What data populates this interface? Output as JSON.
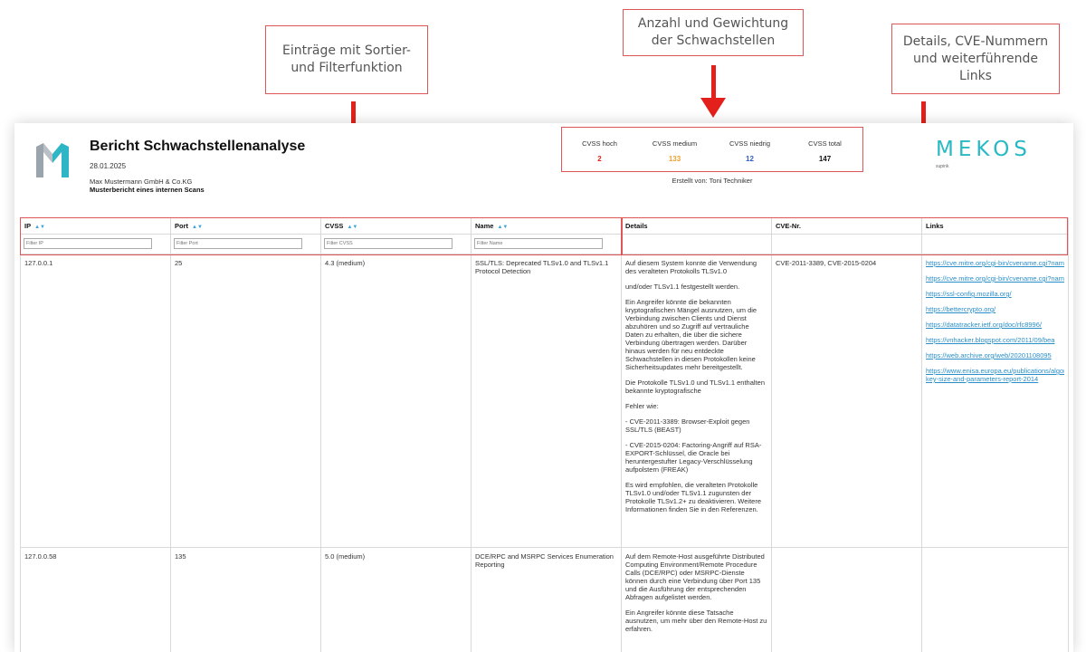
{
  "annotations": {
    "sort_filter": "Einträge mit Sortier-\nund Filterfunktion",
    "count_weight": "Anzahl und Gewichtung\nder Schwachstellen",
    "details_links": "Details, CVE-Nummern\nund weiterführende\nLinks"
  },
  "report": {
    "title": "Bericht Schwachstellenanalyse",
    "date": "28.01.2025",
    "company": "Max Mustermann GmbH & Co.KG",
    "subtitle": "Musterbericht eines internen Scans",
    "brand": "MEKOS",
    "brand_sub": "supink",
    "created_by": "Erstellt von: Toni Techniker"
  },
  "stats": [
    {
      "label": "CVSS hoch",
      "value": "2",
      "color": "#e3201b"
    },
    {
      "label": "CVSS medium",
      "value": "133",
      "color": "#f0a030"
    },
    {
      "label": "CVSS niedrig",
      "value": "12",
      "color": "#2f5fc4"
    },
    {
      "label": "CVSS total",
      "value": "147",
      "color": "#111111"
    }
  ],
  "table": {
    "headers": [
      "IP",
      "Port",
      "CVSS",
      "Name",
      "Details",
      "CVE-Nr.",
      "Links"
    ],
    "sort_icon": "▲▼",
    "filter_placeholders": [
      "Filter IP",
      "Filter Port",
      "Filter CVSS",
      "Filter Name"
    ],
    "rows": [
      {
        "ip": "127.0.0.1",
        "port": "25",
        "cvss": "4.3 (medium)",
        "name": "SSL/TLS: Deprecated TLSv1.0 and TLSv1.1 Protocol Detection",
        "details": [
          "Auf diesem System konnte die Verwendung des veralteten Protokolls TLSv1.0",
          "und/oder TLSv1.1 festgestellt werden.",
          "Ein Angreifer könnte die bekannten kryptografischen Mängel ausnutzen, um die Verbindung zwischen Clients und Dienst abzuhören und so Zugriff auf vertrauliche Daten zu erhalten, die über die sichere Verbindung übertragen werden. Darüber hinaus werden für neu entdeckte Schwachstellen in diesen Protokollen keine Sicherheitsupdates mehr bereitgestellt.",
          "Die Protokolle TLSv1.0 und TLSv1.1 enthalten bekannte kryptografische",
          "Fehler wie:",
          "- CVE-2011-3389: Browser-Exploit gegen SSL/TLS (BEAST)",
          "- CVE-2015-0204: Factoring-Angriff auf RSA-EXPORT-Schlüssel, die Oracle bei heruntergestufter Legacy-Verschlüsselung aufpolstern (FREAK)",
          "Es wird empfohlen, die veralteten Protokolle TLSv1.0 und/oder TLSv1.1 zugunsten der Protokolle TLSv1.2+ zu deaktivieren. Weitere Informationen finden Sie in den Referenzen."
        ],
        "cve": "CVE-2011-3389, CVE-2015-0204",
        "links": [
          "https://cve.mitre.org/cgi-bin/cvename.cgi?name=CVE-2011-3389",
          "https://cve.mitre.org/cgi-bin/cvename.cgi?name=CVE-2015-0204",
          "https://ssl-config.mozilla.org/",
          "https://bettercrypto.org/",
          "https://datatracker.ietf.org/doc/rfc8996/",
          "https://vnhacker.blogspot.com/2011/09/bea",
          "https://web.archive.org/web/20201108095",
          "https://www.enisa.europa.eu/publications/algorithms-key-size-and-parameters-report-2014"
        ]
      },
      {
        "ip": "127.0.0.58",
        "port": "135",
        "cvss": "5.0 (medium)",
        "name": "DCE/RPC and MSRPC Services Enumeration Reporting",
        "details": [
          "Auf dem Remote-Host ausgeführte Distributed Computing Environment/Remote Procedure Calls (DCE/RPC) oder MSRPC-Dienste können durch eine Verbindung über Port 135 und die Ausführung der entsprechenden Abfragen aufgelistet werden.",
          "Ein Angreifer könnte diese Tatsache ausnutzen, um mehr über den Remote-Host zu erfahren."
        ],
        "cve": "",
        "links": []
      }
    ]
  }
}
